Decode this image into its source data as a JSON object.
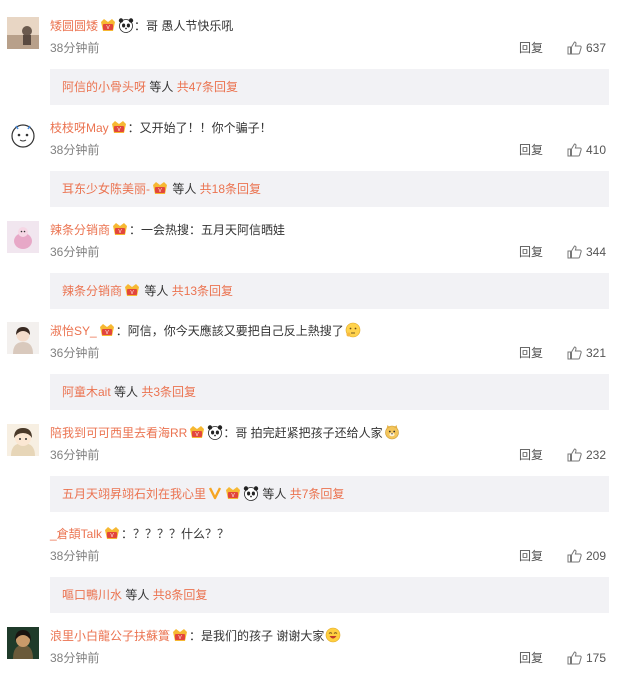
{
  "colors": {
    "name": "#eb7350",
    "link": "#eb7350",
    "time": "#808080",
    "subbg": "#f2f2f5"
  },
  "like_icon": "thumbs-up-icon",
  "comments": [
    {
      "user": "矮圆圆矮",
      "badges": [
        "vip-icon",
        "panda-emoji-icon"
      ],
      "text": "：哥 愚人节快乐吼",
      "time": "38分钟前",
      "reply": "回复",
      "likes": "637",
      "sub": {
        "users": "阿信的小骨头呀",
        "etc": " 等人 ",
        "count": "共47条回复"
      }
    },
    {
      "user": "枝枝呀May",
      "badges": [
        "vip-icon"
      ],
      "text": "：又开始了！！你个骗子！",
      "time": "38分钟前",
      "reply": "回复",
      "likes": "410",
      "sub": {
        "users": "耳东少女陈美丽-",
        "etc": " 等人 ",
        "count": "共18条回复"
      }
    },
    {
      "user": "辣条分销商",
      "badges": [
        "vip-icon"
      ],
      "text": "：一会热搜：五月天阿信晒娃",
      "time": "36分钟前",
      "reply": "回复",
      "likes": "344",
      "sub": {
        "users": "辣条分销商",
        "etc": " 等人 ",
        "count": "共13条回复"
      }
    },
    {
      "user": "淑怡SY_",
      "badges": [
        "vip-icon"
      ],
      "text": "：阿信，你今天應該又要把自己反上熱搜了",
      "time": "36分钟前",
      "reply": "回复",
      "likes": "321",
      "sub": {
        "users": "阿童木ait",
        "etc": " 等人 ",
        "count": "共3条回复"
      }
    },
    {
      "user": "陪我到可可西里去看海RR",
      "badges": [
        "vip-icon",
        "panda-emoji-icon"
      ],
      "text": "：哥 拍完赶紧把孩子还给人家",
      "time": "36分钟前",
      "reply": "回复",
      "likes": "232",
      "sub": {
        "users": "五月天翊昇翊石刘在我心里",
        "etc": " 等人 ",
        "count": "共7条回复"
      }
    },
    {
      "user": "_倉頡Talk",
      "badges": [
        "vip-icon"
      ],
      "text": "：？？？？什么？？",
      "time": "38分钟前",
      "reply": "回复",
      "likes": "209",
      "sub": {
        "users": "嘔口鴨川水",
        "etc": " 等人 ",
        "count": "共8条回复"
      }
    },
    {
      "user": "浪里小白龍公子扶蘇簣",
      "badges": [
        "vip-icon"
      ],
      "text": "：是我们的孩子 谢谢大家",
      "time": "38分钟前",
      "reply": "回复",
      "likes": "175"
    }
  ]
}
